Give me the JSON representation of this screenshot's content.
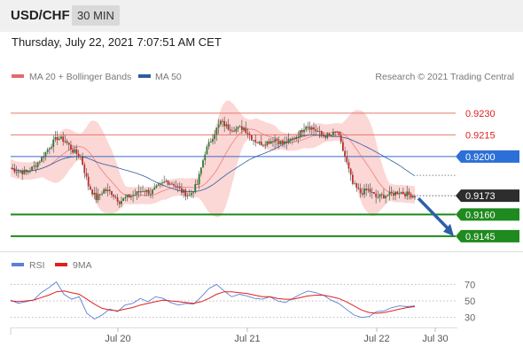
{
  "header": {
    "symbol": "USD/CHF",
    "timeframe": "30 MIN"
  },
  "datetime": "Thursday, July 22, 2021 7:07:51 AM CET",
  "legend": {
    "ma20_label": "MA 20 + Bollinger Bands",
    "ma50_label": "MA 50",
    "copyright": "Research © 2021 Trading Central",
    "rsi_label": "RSI",
    "ma9_label": "9MA"
  },
  "colors": {
    "resistance": "#e8776f",
    "pivot": "#3a68c8",
    "support": "#1a8a1a",
    "current": "#2d2d2d",
    "bollinger": "#f9c9c7",
    "ma20": "#e36b6b",
    "ma50": "#2f5c9e",
    "candle_up": "#2d7a2d",
    "candle_down": "#c02a2a",
    "arrow": "#2d5fa8",
    "rsi": "#5b7fd6",
    "ma9": "#e02020"
  },
  "chart_data": [
    {
      "type": "candlestick",
      "title": "",
      "x_ticks": [
        "Jul 20",
        "Jul 21",
        "Jul 22",
        "Jul 30"
      ],
      "ylim": [
        0.9137,
        0.9247
      ],
      "levels": [
        {
          "role": "resistance",
          "value": "0.9230"
        },
        {
          "role": "resistance",
          "value": "0.9215"
        },
        {
          "role": "pivot",
          "value": "0.9200"
        },
        {
          "role": "current",
          "value": "0.9173"
        },
        {
          "role": "support",
          "value": "0.9160"
        },
        {
          "role": "support",
          "value": "0.9145"
        }
      ],
      "close_path": [
        [
          0,
          0.9192
        ],
        [
          4,
          0.919
        ],
        [
          8,
          0.9189
        ],
        [
          12,
          0.9193
        ],
        [
          16,
          0.9199
        ],
        [
          20,
          0.9207
        ],
        [
          24,
          0.9213
        ],
        [
          28,
          0.9211
        ],
        [
          32,
          0.9204
        ],
        [
          36,
          0.92
        ],
        [
          40,
          0.918
        ],
        [
          44,
          0.9171
        ],
        [
          48,
          0.9177
        ],
        [
          52,
          0.9175
        ],
        [
          56,
          0.9169
        ],
        [
          60,
          0.9172
        ],
        [
          64,
          0.9174
        ],
        [
          68,
          0.9177
        ],
        [
          72,
          0.9175
        ],
        [
          76,
          0.9179
        ],
        [
          80,
          0.9183
        ],
        [
          84,
          0.9181
        ],
        [
          88,
          0.9176
        ],
        [
          92,
          0.9173
        ],
        [
          96,
          0.9181
        ],
        [
          100,
          0.9203
        ],
        [
          104,
          0.9214
        ],
        [
          108,
          0.9224
        ],
        [
          112,
          0.922
        ],
        [
          116,
          0.9219
        ],
        [
          120,
          0.922
        ],
        [
          124,
          0.9213
        ],
        [
          128,
          0.9209
        ],
        [
          132,
          0.921
        ],
        [
          136,
          0.9212
        ],
        [
          140,
          0.9209
        ],
        [
          144,
          0.9211
        ],
        [
          148,
          0.9215
        ],
        [
          152,
          0.9222
        ],
        [
          156,
          0.9219
        ],
        [
          160,
          0.9215
        ],
        [
          164,
          0.9214
        ],
        [
          168,
          0.9217
        ],
        [
          172,
          0.92
        ],
        [
          176,
          0.9181
        ],
        [
          180,
          0.9175
        ],
        [
          184,
          0.9177
        ],
        [
          188,
          0.9172
        ],
        [
          192,
          0.9173
        ],
        [
          196,
          0.9174
        ],
        [
          200,
          0.9176
        ],
        [
          204,
          0.9174
        ],
        [
          208,
          0.9173
        ]
      ],
      "forecast": {
        "from": 0.9173,
        "to": 0.9145
      }
    },
    {
      "type": "line",
      "title": "",
      "series": [
        {
          "name": "RSI",
          "values": [
            51,
            47,
            49,
            51,
            60,
            66,
            73,
            58,
            52,
            55,
            35,
            28,
            33,
            40,
            37,
            45,
            47,
            53,
            49,
            55,
            53,
            48,
            45,
            47,
            46,
            55,
            65,
            70,
            62,
            55,
            58,
            56,
            53,
            52,
            55,
            50,
            48,
            53,
            58,
            62,
            60,
            57,
            51,
            47,
            40,
            33,
            30,
            31,
            37,
            38,
            42,
            44,
            43,
            44
          ]
        },
        {
          "name": "9MA",
          "values": [
            50,
            49,
            50,
            51,
            54,
            57,
            61,
            62,
            60,
            58,
            52,
            46,
            41,
            39,
            38,
            40,
            42,
            45,
            47,
            49,
            51,
            50,
            49,
            48,
            47,
            49,
            53,
            58,
            61,
            61,
            60,
            59,
            57,
            55,
            55,
            53,
            52,
            52,
            54,
            56,
            57,
            57,
            55,
            53,
            49,
            44,
            39,
            36,
            35,
            36,
            38,
            40,
            42,
            43
          ]
        }
      ],
      "ylim": [
        20,
        80
      ],
      "y_ticks": [
        "70",
        "50",
        "30"
      ],
      "x_ticks": [
        "Jul 20",
        "Jul 21",
        "Jul 22",
        "Jul 30"
      ]
    }
  ]
}
